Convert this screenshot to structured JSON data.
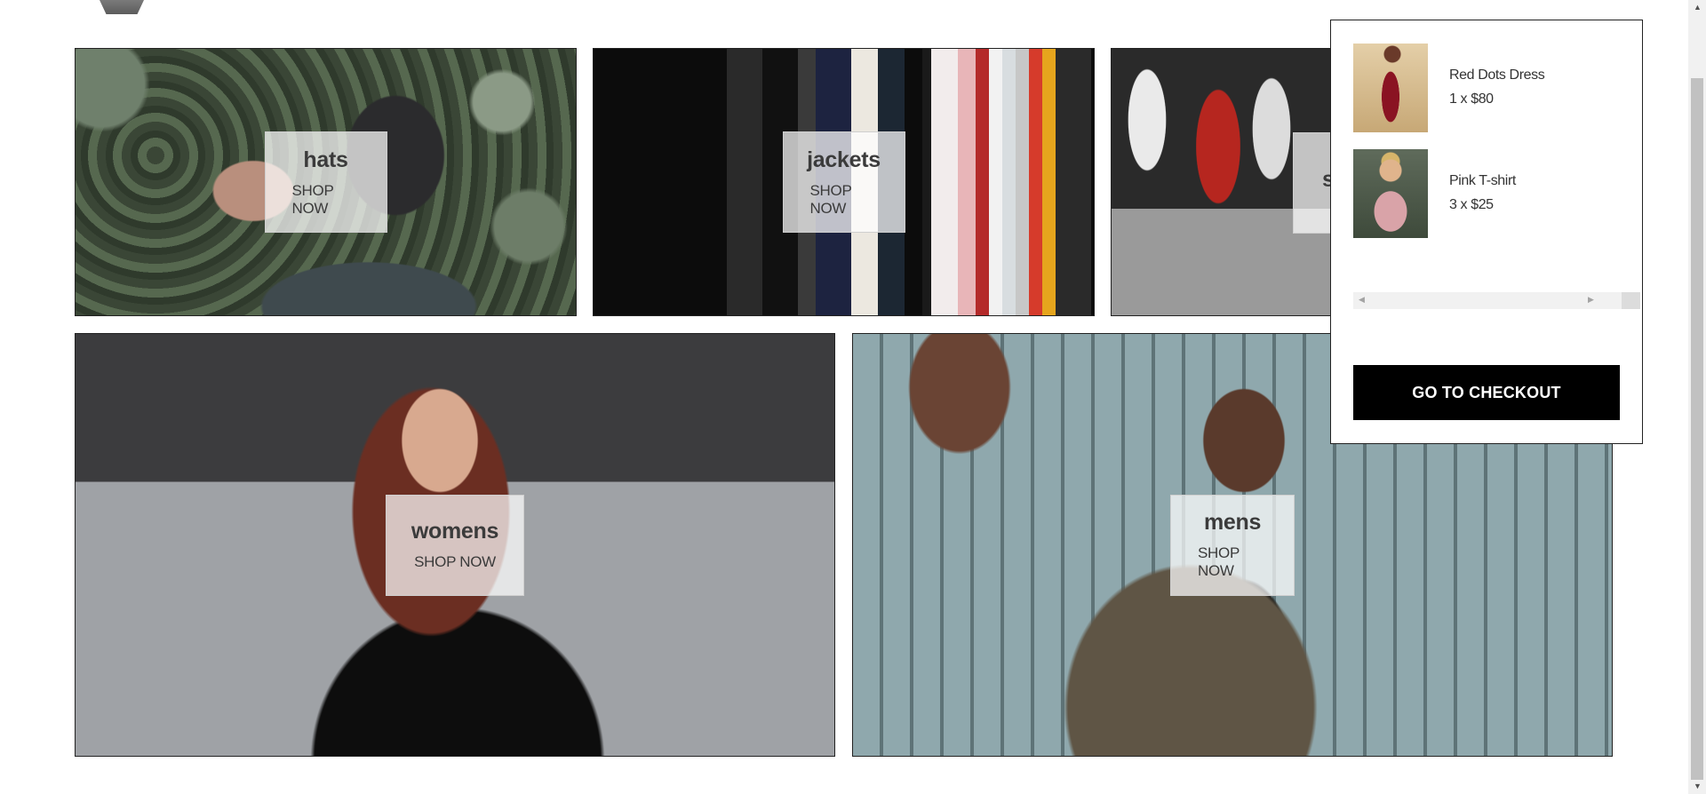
{
  "categories": [
    {
      "title": "hats",
      "cta": "SHOP NOW"
    },
    {
      "title": "jackets",
      "cta": "SHOP NOW"
    },
    {
      "title": "s",
      "cta": ""
    },
    {
      "title": "womens",
      "cta": "SHOP NOW"
    },
    {
      "title": "mens",
      "cta": "SHOP NOW"
    }
  ],
  "cart": {
    "items": [
      {
        "name": "Red Dots Dress",
        "qty_price": "1 x $80"
      },
      {
        "name": "Pink T-shirt",
        "qty_price": "3 x $25"
      }
    ],
    "checkout_label": "GO TO CHECKOUT"
  },
  "icons": {
    "scroll_up": "▲",
    "scroll_down": "▼",
    "scroll_left": "◀",
    "scroll_right": "▶"
  }
}
